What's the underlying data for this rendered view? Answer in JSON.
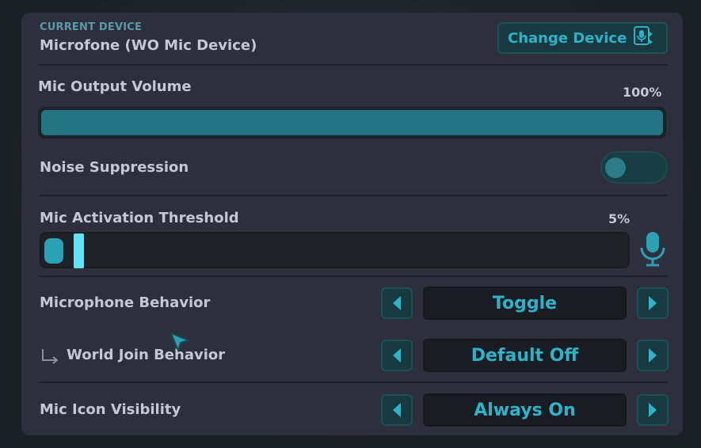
{
  "device": {
    "caption": "CURRENT DEVICE",
    "name": "Microfone (WO Mic Device)",
    "change_label": "Change Device",
    "change_icon": "swap-mic-icon"
  },
  "output_volume": {
    "label": "Mic Output Volume",
    "value_text": "100%",
    "value": 1.0
  },
  "noise_suppression": {
    "label": "Noise Suppression",
    "enabled": false
  },
  "activation_threshold": {
    "label": "Mic Activation Threshold",
    "value_text": "5%",
    "value": 0.05,
    "icon": "microphone-icon"
  },
  "rows": [
    {
      "label": "Microphone Behavior",
      "value": "Toggle"
    },
    {
      "label": "World Join Behavior",
      "value": "Default Off"
    },
    {
      "label": "Mic Icon Visibility",
      "value": "Always On"
    }
  ],
  "colors": {
    "accent": "#2bb3c8",
    "panel": "#2d2f3d",
    "button_bg": "#163a40"
  }
}
